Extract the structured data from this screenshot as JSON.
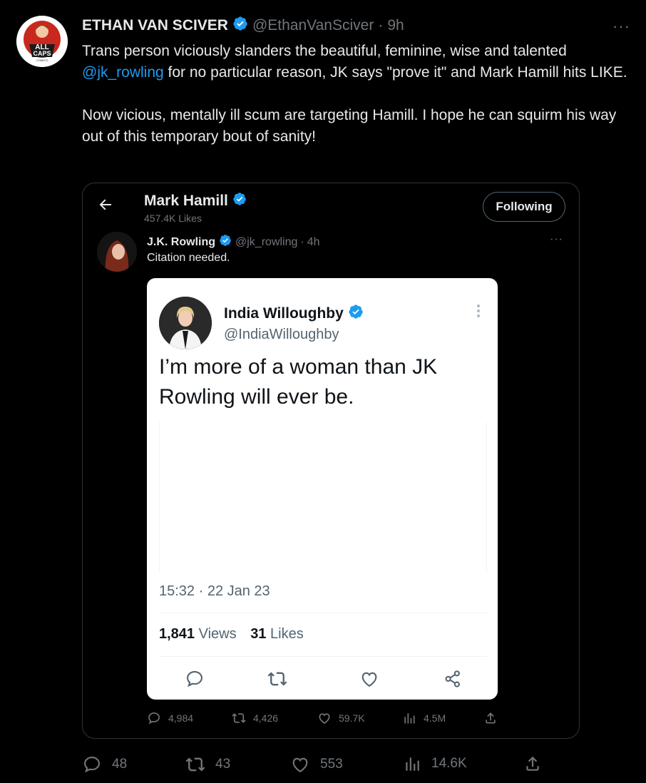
{
  "tweet": {
    "author_name": "ETHAN VAN SCIVER",
    "handle": "@EthanVanSciver",
    "separator": "·",
    "time_ago": "9h",
    "more_label": "···",
    "text_p1_part1": "Trans person viciously slanders the beautiful, feminine, wise and talented ",
    "text_mention": "@jk_rowling",
    "text_p1_part2": " for no particular reason, JK says \"prove it\" and Mark Hamill hits LIKE.",
    "text_p2": "Now vicious, mentally ill scum are targeting Hamill. I hope he can squirm his way out of this temporary bout of sanity!",
    "avatar_logo_text": [
      "ALL",
      "CAPS",
      "COMICS"
    ],
    "stats": {
      "replies": "48",
      "retweets": "43",
      "likes": "553",
      "views": "14.6K"
    }
  },
  "embedded": {
    "profile_name": "Mark Hamill",
    "profile_likes": "457.4K Likes",
    "following_label": "Following",
    "reply": {
      "name": "J.K. Rowling",
      "handle": "@jk_rowling",
      "separator": "·",
      "time_ago": "4h",
      "more_label": "···",
      "text": "Citation needed."
    },
    "quoted": {
      "name": "India Willoughby",
      "handle": "@IndiaWilloughby",
      "text": "I’m more of a woman than JK Rowling will ever be.",
      "timestamp": "15:32 · 22 Jan 23",
      "views_count": "1,841",
      "views_label": "Views",
      "likes_count": "31",
      "likes_label": "Likes"
    },
    "stats": {
      "replies": "4,984",
      "retweets": "4,426",
      "likes": "59.7K",
      "views": "4.5M"
    }
  },
  "colors": {
    "background": "#000000",
    "text_primary": "#e7e9ea",
    "text_secondary": "#71767b",
    "link": "#1d9bf0",
    "verified": "#1d9bf0",
    "logo_red": "#c8281e"
  },
  "icons": [
    "verified-badge-icon",
    "more-icon",
    "back-arrow-icon",
    "reply-icon",
    "retweet-icon",
    "like-icon",
    "views-icon",
    "share-icon"
  ]
}
